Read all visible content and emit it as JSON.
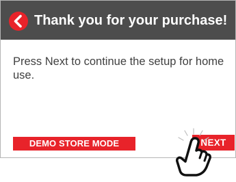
{
  "header": {
    "title": "Thank you for your purchase!",
    "back_icon": "chevron-left-icon"
  },
  "main": {
    "message": "Press Next to continue the setup for home use."
  },
  "footer": {
    "demo_badge": "DEMO STORE MODE",
    "next_label": "NEXT"
  },
  "overlay": {
    "pointer_icon": "hand-pointer-icon"
  },
  "colors": {
    "titlebar": "#4d4d4d",
    "accent": "#e8232a",
    "text": "#404040"
  }
}
